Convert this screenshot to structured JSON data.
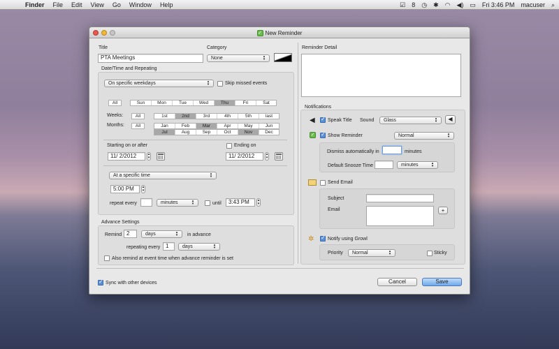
{
  "menubar": {
    "apple": "",
    "app": "Finder",
    "items": [
      "File",
      "Edit",
      "View",
      "Go",
      "Window",
      "Help"
    ],
    "clock": "Fri 3:46 PM",
    "user": "macuser"
  },
  "window": {
    "title": "New Reminder",
    "title_label": "Title",
    "title_value": "PTA Meetings",
    "category_label": "Category",
    "category_value": "None",
    "reminder_detail_label": "Reminder Detail",
    "datetime_section": "Date/Time and Repeating",
    "repeat_mode": "On specific weekdays",
    "skip_missed": "Skip missed events",
    "days": [
      "All",
      "Sun",
      "Mon",
      "Tue",
      "Wed",
      "Thu",
      "Fri",
      "Sat"
    ],
    "weeks_label": "Weeks:",
    "weeks": [
      "All",
      "1st",
      "2nd",
      "3rd",
      "4th",
      "5th",
      "last"
    ],
    "months_label": "Months:",
    "months_all": "All",
    "months_row1": [
      "Jan",
      "Feb",
      "Mar",
      "Apr",
      "May",
      "Jun"
    ],
    "months_row2": [
      "Jul",
      "Aug",
      "Sep",
      "Oct",
      "Nov",
      "Dec"
    ],
    "starting_label": "Starting on or after",
    "starting_value": "11/ 2/2012",
    "ending_label": "Ending on",
    "ending_value": "11/ 2/2012",
    "time_mode": "At a specific time",
    "time_value": "5:00 PM",
    "repeat_every_label": "repeat every",
    "repeat_unit": "minutes",
    "until_label": "until",
    "until_value": "3:43 PM",
    "advance_section": "Advance Settings",
    "remind_label": "Remind",
    "remind_value": "2",
    "remind_unit": "days",
    "in_advance_label": "in advance",
    "repeating_every_label": "repeating every",
    "repeating_value": "1",
    "repeating_unit": "days",
    "also_remind": "Also remind at event time when advance reminder is set",
    "sync_label": "Sync with other devices",
    "cancel": "Cancel",
    "save": "Save",
    "notifications_label": "Notifications",
    "speak_title": "Speak Title",
    "sound_label": "Sound",
    "sound_value": "Glass",
    "show_reminder": "Show Reminder",
    "show_reminder_mode": "Normal",
    "dismiss_label": "Dismiss automatically in",
    "dismiss_unit": "minutes",
    "snooze_label": "Default Snooze Time",
    "snooze_unit": "minutes",
    "send_email": "Send Email",
    "subject_label": "Subject",
    "email_label": "Email",
    "add_label": "+",
    "notify_growl": "Notify using Growl",
    "priority_label": "Priority",
    "priority_value": "Normal",
    "sticky_label": "Sticky"
  },
  "colors": {
    "accent": "#5b8fd4",
    "selected_segment": "#a8a8a8"
  }
}
